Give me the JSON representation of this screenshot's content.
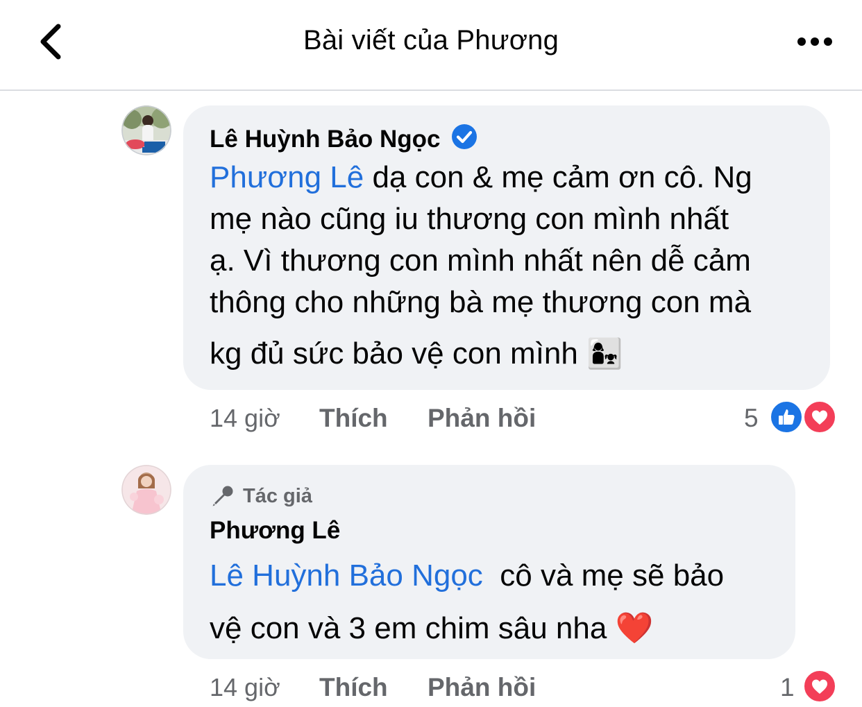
{
  "header": {
    "title": "Bài viết của Phương",
    "back_icon": "chevron-left-icon",
    "more_icon": "more-dots-icon"
  },
  "comments": [
    {
      "author": "Lê Huỳnh Bảo Ngọc",
      "verified": true,
      "mention": "Phương Lê",
      "text_line1": " dạ con & mẹ cảm ơn cô. Ng",
      "text_line2": "mẹ nào cũng iu thương con mình nhất",
      "text_line3": "ạ. Vì thương con mình nhất nên dễ cảm",
      "text_line4": "thông cho những bà mẹ thương con mà",
      "text_line5": "kg đủ sức bảo vệ con mình ",
      "emoji": "👩‍👧",
      "time": "14 giờ",
      "like_label": "Thích",
      "reply_label": "Phản hồi",
      "reaction_count": "5",
      "reactions": [
        "like-reaction-icon",
        "love-reaction-icon"
      ]
    },
    {
      "author_badge": "Tác giả",
      "author": "Phương Lê",
      "mention": "Lê Huỳnh Bảo Ngọc",
      "text_line1": "  cô và mẹ sẽ bảo",
      "text_line2": "vệ con và 3 em chim sâu nha ",
      "emoji": "❤️",
      "time": "14 giờ",
      "like_label": "Thích",
      "reply_label": "Phản hồi",
      "reaction_count": "1",
      "reactions": [
        "love-reaction-icon"
      ]
    }
  ],
  "colors": {
    "link": "#216fdb",
    "bubble": "#f0f2f5",
    "meta": "#65676b",
    "like_blue": "#1b74e4",
    "love_red": "#f33e58"
  }
}
